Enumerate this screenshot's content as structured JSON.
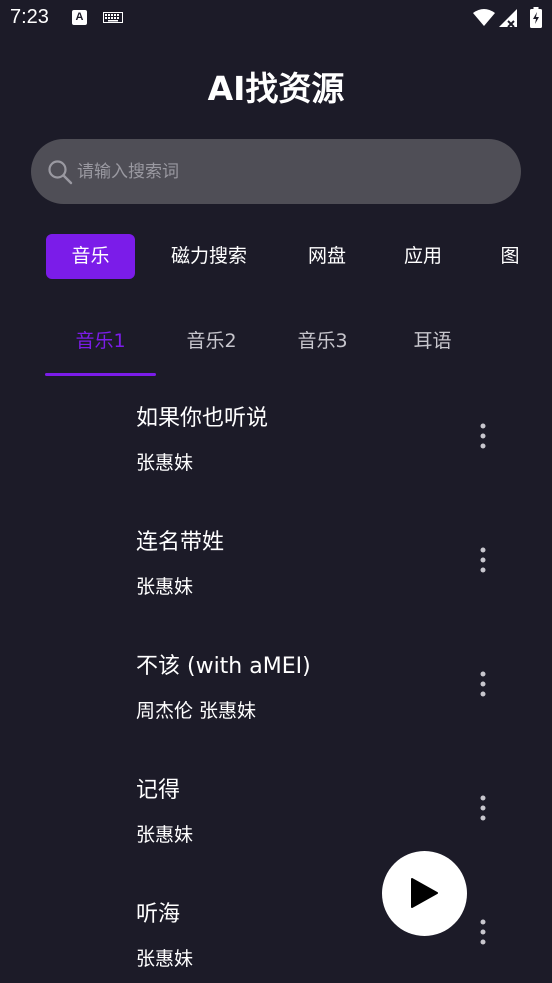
{
  "status_bar": {
    "time": "7:23",
    "a_label": "A"
  },
  "app": {
    "title": "AI找资源"
  },
  "search": {
    "placeholder": "请输入搜索词"
  },
  "categories": [
    {
      "label": "音乐",
      "active": true
    },
    {
      "label": "磁力搜索",
      "active": false
    },
    {
      "label": "网盘",
      "active": false
    },
    {
      "label": "应用",
      "active": false
    },
    {
      "label": "图",
      "active": false
    }
  ],
  "sub_tabs": [
    {
      "label": "音乐1",
      "active": true
    },
    {
      "label": "音乐2",
      "active": false
    },
    {
      "label": "音乐3",
      "active": false
    },
    {
      "label": "耳语",
      "active": false
    }
  ],
  "songs": [
    {
      "title": "如果你也听说",
      "artist": "张惠妹"
    },
    {
      "title": "连名带姓",
      "artist": "张惠妹"
    },
    {
      "title": "不该 (with aMEI)",
      "artist": "周杰伦 张惠妹"
    },
    {
      "title": "记得",
      "artist": "张惠妹"
    },
    {
      "title": "听海",
      "artist": "张惠妹"
    }
  ],
  "colors": {
    "background": "#1c1b28",
    "accent": "#7b1ce9",
    "search_bg": "#4f4e56"
  },
  "icons": {
    "search": "search-icon",
    "more": "more-vertical-icon",
    "play": "play-icon",
    "wifi": "wifi-icon",
    "signal": "signal-icon",
    "battery": "battery-icon",
    "keyboard": "keyboard-icon"
  }
}
